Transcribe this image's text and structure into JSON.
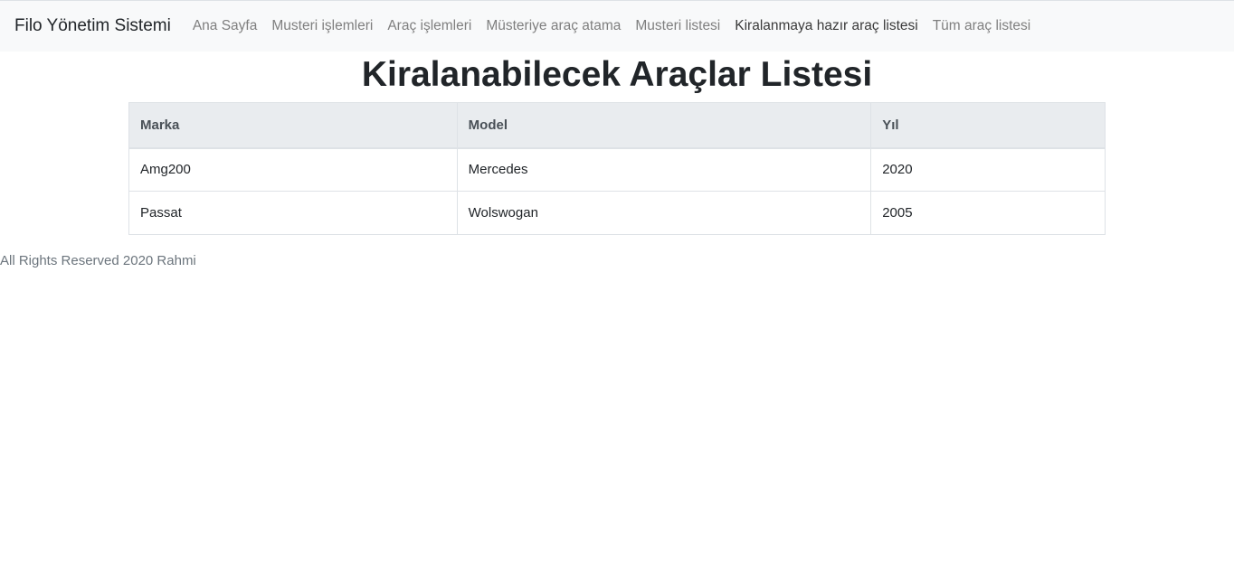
{
  "navbar": {
    "brand": "Filo Yönetim Sistemi",
    "links": [
      {
        "label": "Ana Sayfa"
      },
      {
        "label": "Musteri işlemleri"
      },
      {
        "label": "Araç işlemleri"
      },
      {
        "label": "Müsteriye araç atama"
      },
      {
        "label": "Musteri listesi"
      },
      {
        "label": "Kiralanmaya hazır araç listesi"
      },
      {
        "label": "Tüm araç listesi"
      }
    ],
    "active_index": 5
  },
  "page": {
    "title": "Kiralanabilecek Araçlar Listesi"
  },
  "table": {
    "headers": [
      "Marka",
      "Model",
      "Yıl"
    ],
    "rows": [
      [
        "Amg200",
        "Mercedes",
        "2020"
      ],
      [
        "Passat",
        "Wolswogan",
        "2005"
      ]
    ]
  },
  "footer": {
    "text": "All Rights Reserved 2020 Rahmi"
  },
  "colors": {
    "navbar_bg": "#f8f9fa",
    "header_bg": "#e9ecef",
    "border": "#dee2e6"
  }
}
